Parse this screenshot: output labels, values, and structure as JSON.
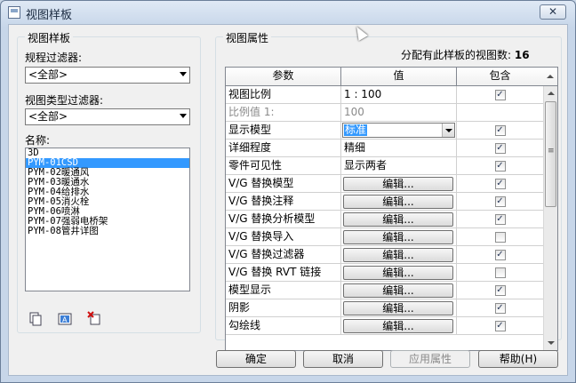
{
  "window": {
    "title": "视图样板",
    "close_glyph": "✕"
  },
  "left_panel": {
    "group_title": "视图样板",
    "discipline_filter_label": "规程过滤器:",
    "discipline_filter_value": "<全部>",
    "view_type_filter_label": "视图类型过滤器:",
    "view_type_filter_value": "<全部>",
    "names_label": "名称:",
    "names": [
      "3D",
      "PYM-01CSD",
      "PYM-02暖通风",
      "PYM-03暖通水",
      "PYM-04给排水",
      "PYM-05消火栓",
      "PYM-06喷淋",
      "PYM-07强弱电桥架",
      "PYM-08管井详图"
    ],
    "selected_index": 1,
    "tools": [
      "duplicate-icon",
      "rename-icon",
      "delete-icon"
    ]
  },
  "right_panel": {
    "group_title": "视图属性",
    "assigned_label": "分配有此样板的视图数:",
    "assigned_count": "16",
    "columns": [
      "参数",
      "值",
      "包含"
    ],
    "rows": [
      {
        "param": "视图比例",
        "value": "1 : 100",
        "kind": "text",
        "include": true,
        "disabled": false
      },
      {
        "param": "比例值 1:",
        "value": "100",
        "kind": "text",
        "include": null,
        "disabled": true
      },
      {
        "param": "显示模型",
        "value": "标准",
        "kind": "select",
        "include": true,
        "disabled": false
      },
      {
        "param": "详细程度",
        "value": "精细",
        "kind": "text",
        "include": true,
        "disabled": false
      },
      {
        "param": "零件可见性",
        "value": "显示两者",
        "kind": "text",
        "include": true,
        "disabled": false
      },
      {
        "param": "V/G 替换模型",
        "value": "编辑...",
        "kind": "button",
        "include": true,
        "disabled": false
      },
      {
        "param": "V/G 替换注释",
        "value": "编辑...",
        "kind": "button",
        "include": true,
        "disabled": false
      },
      {
        "param": "V/G 替换分析模型",
        "value": "编辑...",
        "kind": "button",
        "include": true,
        "disabled": false
      },
      {
        "param": "V/G 替换导入",
        "value": "编辑...",
        "kind": "button",
        "include": false,
        "disabled": false
      },
      {
        "param": "V/G 替换过滤器",
        "value": "编辑...",
        "kind": "button",
        "include": true,
        "disabled": false
      },
      {
        "param": "V/G 替换 RVT 链接",
        "value": "编辑...",
        "kind": "button",
        "include": false,
        "disabled": false
      },
      {
        "param": "模型显示",
        "value": "编辑...",
        "kind": "button",
        "include": true,
        "disabled": false
      },
      {
        "param": "阴影",
        "value": "编辑...",
        "kind": "button",
        "include": true,
        "disabled": false
      },
      {
        "param": "勾绘线",
        "value": "编辑...",
        "kind": "button",
        "include": true,
        "disabled": false
      }
    ]
  },
  "footer": {
    "ok": "确定",
    "cancel": "取消",
    "apply": "应用属性",
    "help": "帮助(H)"
  },
  "checkmark_glyph": "✓"
}
